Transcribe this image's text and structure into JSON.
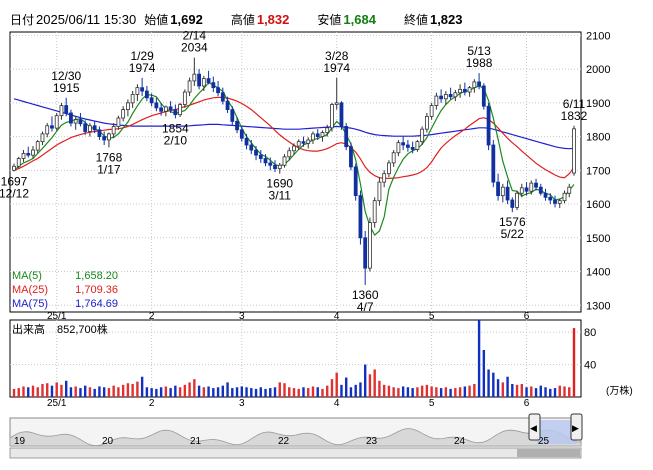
{
  "header": {
    "date_label": "日付",
    "datetime": "2025/06/11 15:30",
    "open_label": "始値",
    "open": "1,692",
    "high_label": "高値",
    "high": "1,832",
    "low_label": "安値",
    "low": "1,684",
    "close_label": "終値",
    "close": "1,823",
    "colors": {
      "high": "#d01010",
      "low": "#108010",
      "text": "#000000"
    }
  },
  "legend": [
    {
      "label": "MA(5)",
      "value": "1,658.20",
      "color": "#1a8a1a"
    },
    {
      "label": "MA(25)",
      "value": "1,709.36",
      "color": "#e02020"
    },
    {
      "label": "MA(75)",
      "value": "1,764.69",
      "color": "#2020d0"
    }
  ],
  "volume_legend": {
    "label": "出来高",
    "value": "852,700株"
  },
  "volume_unit": "(万株)",
  "chart_data": {
    "type": "candlestick",
    "price_axis": {
      "ticks": [
        2100,
        2000,
        1900,
        1800,
        1700,
        1600,
        1500,
        1400,
        1300
      ],
      "ylim": [
        1280,
        2110
      ]
    },
    "volume_axis": {
      "ticks": [
        80,
        40
      ],
      "ylim": [
        0,
        95
      ]
    },
    "month_labels": [
      "25/1",
      "2",
      "3",
      "4",
      "5",
      "6"
    ],
    "month_bar_index": [
      9,
      29,
      48,
      68,
      88,
      108
    ],
    "annotations": [
      {
        "price": "1697",
        "date": "12/12",
        "index": 0,
        "at": "low",
        "pos": "below"
      },
      {
        "price": "1915",
        "date": "12/30",
        "index": 11,
        "at": "high",
        "pos": "above"
      },
      {
        "price": "1768",
        "date": "1/17",
        "index": 20,
        "at": "low",
        "pos": "below"
      },
      {
        "price": "1974",
        "date": "1/29",
        "index": 27,
        "at": "high",
        "pos": "above"
      },
      {
        "price": "1854",
        "date": "2/10",
        "index": 34,
        "at": "low",
        "pos": "below"
      },
      {
        "price": "2034",
        "date": "2/14",
        "index": 38,
        "at": "high",
        "pos": "above"
      },
      {
        "price": "1690",
        "date": "3/11",
        "index": 56,
        "at": "low",
        "pos": "below"
      },
      {
        "price": "1974",
        "date": "3/28",
        "index": 68,
        "at": "high",
        "pos": "above"
      },
      {
        "price": "1360",
        "date": "4/7",
        "index": 74,
        "at": "low",
        "pos": "below"
      },
      {
        "price": "1988",
        "date": "5/13",
        "index": 98,
        "at": "high",
        "pos": "above"
      },
      {
        "price": "1576",
        "date": "5/22",
        "index": 105,
        "at": "low",
        "pos": "below"
      },
      {
        "price": "1832",
        "date": "6/11",
        "index": 118,
        "at": "high",
        "pos": "above"
      }
    ],
    "candles": [
      [
        1700,
        1720,
        1697,
        1712
      ],
      [
        1712,
        1740,
        1705,
        1735
      ],
      [
        1735,
        1760,
        1725,
        1750
      ],
      [
        1750,
        1770,
        1738,
        1745
      ],
      [
        1745,
        1772,
        1735,
        1760
      ],
      [
        1760,
        1790,
        1750,
        1785
      ],
      [
        1785,
        1815,
        1775,
        1808
      ],
      [
        1808,
        1840,
        1798,
        1832
      ],
      [
        1832,
        1860,
        1815,
        1825
      ],
      [
        1825,
        1870,
        1818,
        1862
      ],
      [
        1862,
        1900,
        1850,
        1892
      ],
      [
        1892,
        1915,
        1860,
        1870
      ],
      [
        1870,
        1880,
        1830,
        1840
      ],
      [
        1840,
        1860,
        1820,
        1850
      ],
      [
        1850,
        1870,
        1830,
        1838
      ],
      [
        1838,
        1848,
        1805,
        1815
      ],
      [
        1815,
        1840,
        1800,
        1832
      ],
      [
        1832,
        1845,
        1810,
        1820
      ],
      [
        1820,
        1830,
        1790,
        1800
      ],
      [
        1800,
        1815,
        1775,
        1790
      ],
      [
        1790,
        1812,
        1768,
        1808
      ],
      [
        1808,
        1840,
        1795,
        1830
      ],
      [
        1830,
        1862,
        1820,
        1855
      ],
      [
        1855,
        1890,
        1845,
        1880
      ],
      [
        1880,
        1910,
        1860,
        1900
      ],
      [
        1900,
        1935,
        1885,
        1925
      ],
      [
        1925,
        1955,
        1905,
        1945
      ],
      [
        1945,
        1974,
        1920,
        1935
      ],
      [
        1935,
        1950,
        1905,
        1915
      ],
      [
        1915,
        1928,
        1890,
        1900
      ],
      [
        1900,
        1915,
        1875,
        1885
      ],
      [
        1885,
        1900,
        1862,
        1875
      ],
      [
        1875,
        1892,
        1860,
        1888
      ],
      [
        1888,
        1905,
        1870,
        1880
      ],
      [
        1880,
        1895,
        1854,
        1865
      ],
      [
        1865,
        1900,
        1858,
        1895
      ],
      [
        1895,
        1940,
        1885,
        1932
      ],
      [
        1932,
        1975,
        1920,
        1965
      ],
      [
        1965,
        2034,
        1950,
        1985
      ],
      [
        1985,
        2000,
        1940,
        1950
      ],
      [
        1950,
        1980,
        1935,
        1972
      ],
      [
        1972,
        1995,
        1955,
        1960
      ],
      [
        1960,
        1978,
        1932,
        1945
      ],
      [
        1945,
        1965,
        1920,
        1930
      ],
      [
        1930,
        1945,
        1895,
        1905
      ],
      [
        1905,
        1918,
        1870,
        1880
      ],
      [
        1880,
        1890,
        1835,
        1845
      ],
      [
        1845,
        1858,
        1810,
        1820
      ],
      [
        1820,
        1832,
        1785,
        1795
      ],
      [
        1795,
        1808,
        1762,
        1775
      ],
      [
        1775,
        1790,
        1748,
        1760
      ],
      [
        1760,
        1772,
        1730,
        1745
      ],
      [
        1745,
        1760,
        1722,
        1735
      ],
      [
        1735,
        1748,
        1712,
        1722
      ],
      [
        1722,
        1738,
        1700,
        1715
      ],
      [
        1715,
        1730,
        1695,
        1705
      ],
      [
        1705,
        1722,
        1690,
        1715
      ],
      [
        1715,
        1748,
        1708,
        1740
      ],
      [
        1740,
        1768,
        1730,
        1758
      ],
      [
        1758,
        1780,
        1745,
        1772
      ],
      [
        1772,
        1792,
        1760,
        1785
      ],
      [
        1785,
        1800,
        1770,
        1780
      ],
      [
        1780,
        1798,
        1765,
        1790
      ],
      [
        1790,
        1815,
        1778,
        1808
      ],
      [
        1808,
        1822,
        1790,
        1800
      ],
      [
        1800,
        1818,
        1785,
        1812
      ],
      [
        1812,
        1835,
        1800,
        1826
      ],
      [
        1826,
        1900,
        1815,
        1895
      ],
      [
        1895,
        1974,
        1880,
        1900
      ],
      [
        1900,
        1905,
        1820,
        1830
      ],
      [
        1830,
        1840,
        1760,
        1770
      ],
      [
        1770,
        1782,
        1700,
        1710
      ],
      [
        1710,
        1720,
        1610,
        1625
      ],
      [
        1625,
        1640,
        1480,
        1500
      ],
      [
        1500,
        1520,
        1360,
        1410
      ],
      [
        1410,
        1560,
        1400,
        1545
      ],
      [
        1545,
        1620,
        1530,
        1610
      ],
      [
        1610,
        1680,
        1595,
        1665
      ],
      [
        1665,
        1700,
        1650,
        1690
      ],
      [
        1690,
        1730,
        1680,
        1722
      ],
      [
        1722,
        1760,
        1710,
        1752
      ],
      [
        1752,
        1790,
        1742,
        1782
      ],
      [
        1782,
        1800,
        1760,
        1775
      ],
      [
        1775,
        1790,
        1755,
        1768
      ],
      [
        1768,
        1785,
        1750,
        1762
      ],
      [
        1762,
        1790,
        1755,
        1785
      ],
      [
        1785,
        1830,
        1775,
        1822
      ],
      [
        1822,
        1870,
        1812,
        1860
      ],
      [
        1860,
        1900,
        1850,
        1892
      ],
      [
        1892,
        1930,
        1880,
        1920
      ],
      [
        1920,
        1940,
        1900,
        1912
      ],
      [
        1912,
        1935,
        1895,
        1925
      ],
      [
        1925,
        1945,
        1910,
        1918
      ],
      [
        1918,
        1938,
        1905,
        1930
      ],
      [
        1930,
        1955,
        1915,
        1940
      ],
      [
        1940,
        1960,
        1922,
        1932
      ],
      [
        1932,
        1950,
        1918,
        1945
      ],
      [
        1945,
        1970,
        1930,
        1962
      ],
      [
        1962,
        1988,
        1940,
        1950
      ],
      [
        1950,
        1958,
        1880,
        1890
      ],
      [
        1890,
        1900,
        1760,
        1775
      ],
      [
        1775,
        1790,
        1650,
        1665
      ],
      [
        1665,
        1690,
        1610,
        1625
      ],
      [
        1625,
        1660,
        1605,
        1650
      ],
      [
        1650,
        1670,
        1600,
        1612
      ],
      [
        1612,
        1620,
        1576,
        1590
      ],
      [
        1590,
        1640,
        1582,
        1632
      ],
      [
        1632,
        1660,
        1620,
        1648
      ],
      [
        1648,
        1665,
        1625,
        1638
      ],
      [
        1638,
        1670,
        1628,
        1662
      ],
      [
        1662,
        1675,
        1640,
        1650
      ],
      [
        1650,
        1660,
        1625,
        1632
      ],
      [
        1632,
        1645,
        1610,
        1620
      ],
      [
        1620,
        1632,
        1600,
        1612
      ],
      [
        1612,
        1625,
        1590,
        1602
      ],
      [
        1602,
        1615,
        1588,
        1610
      ],
      [
        1610,
        1640,
        1602,
        1632
      ],
      [
        1632,
        1660,
        1620,
        1650
      ],
      [
        1692,
        1832,
        1684,
        1823
      ]
    ],
    "volumes": [
      10,
      11,
      13,
      12,
      14,
      12,
      16,
      17,
      14,
      18,
      15,
      20,
      12,
      13,
      11,
      14,
      12,
      10,
      13,
      12,
      11,
      14,
      12,
      15,
      17,
      16,
      19,
      25,
      12,
      11,
      10,
      12,
      13,
      11,
      14,
      12,
      15,
      18,
      22,
      14,
      12,
      13,
      11,
      12,
      14,
      18,
      11,
      12,
      13,
      12,
      11,
      10,
      12,
      10,
      11,
      12,
      18,
      17,
      12,
      11,
      10,
      12,
      11,
      13,
      12,
      10,
      14,
      22,
      30,
      15,
      24,
      12,
      15,
      18,
      40,
      28,
      34,
      20,
      15,
      14,
      12,
      11,
      13,
      12,
      11,
      12,
      14,
      15,
      13,
      12,
      11,
      12,
      10,
      11,
      12,
      13,
      14,
      16,
      95,
      58,
      34,
      30,
      22,
      18,
      25,
      16,
      15,
      16,
      12,
      13,
      11,
      14,
      12,
      10,
      11,
      14,
      13,
      12,
      85
    ],
    "ma5": [
      1700,
      1712,
      1722,
      1728,
      1735,
      1750,
      1765,
      1781,
      1797,
      1816,
      1834,
      1842,
      1846,
      1851,
      1853,
      1842,
      1828,
      1823,
      1816,
      1802,
      1795,
      1798,
      1808,
      1826,
      1843,
      1868,
      1891,
      1911,
      1924,
      1923,
      1918,
      1898,
      1882,
      1874,
      1868,
      1873,
      1877,
      1893,
      1913,
      1929,
      1943,
      1960,
      1953,
      1944,
      1934,
      1908,
      1886,
      1856,
      1825,
      1800,
      1782,
      1764,
      1748,
      1741,
      1730,
      1717,
      1713,
      1718,
      1731,
      1747,
      1762,
      1775,
      1781,
      1791,
      1794,
      1800,
      1806,
      1826,
      1845,
      1832,
      1806,
      1779,
      1731,
      1660,
      1578,
      1535,
      1508,
      1520,
      1562,
      1644,
      1680,
      1708,
      1733,
      1749,
      1758,
      1764,
      1777,
      1797,
      1825,
      1852,
      1877,
      1895,
      1909,
      1918,
      1928,
      1934,
      1937,
      1945,
      1950,
      1943,
      1906,
      1855,
      1792,
      1727,
      1680,
      1640,
      1638,
      1624,
      1630,
      1634,
      1644,
      1640,
      1632,
      1628,
      1612,
      1615,
      1622,
      1641,
      1658
    ],
    "ma25": [
      1700,
      1705,
      1712,
      1720,
      1728,
      1735,
      1745,
      1755,
      1765,
      1775,
      1783,
      1790,
      1797,
      1802,
      1806,
      1810,
      1813,
      1815,
      1817,
      1819,
      1821,
      1822,
      1823,
      1826,
      1830,
      1836,
      1843,
      1850,
      1856,
      1862,
      1866,
      1870,
      1874,
      1877,
      1880,
      1884,
      1889,
      1893,
      1898,
      1903,
      1908,
      1912,
      1915,
      1916,
      1916,
      1914,
      1910,
      1905,
      1898,
      1890,
      1880,
      1868,
      1856,
      1844,
      1832,
      1818,
      1805,
      1794,
      1784,
      1774,
      1766,
      1761,
      1758,
      1757,
      1757,
      1760,
      1764,
      1771,
      1779,
      1782,
      1778,
      1768,
      1754,
      1734,
      1710,
      1694,
      1684,
      1678,
      1676,
      1676,
      1677,
      1678,
      1681,
      1683,
      1686,
      1690,
      1697,
      1708,
      1725,
      1747,
      1766,
      1780,
      1792,
      1803,
      1812,
      1822,
      1833,
      1843,
      1853,
      1856,
      1851,
      1840,
      1825,
      1810,
      1795,
      1782,
      1770,
      1757,
      1745,
      1733,
      1721,
      1711,
      1702,
      1694,
      1686,
      1680,
      1678,
      1690,
      1709
    ],
    "ma75": [
      1912,
      1908,
      1904,
      1900,
      1896,
      1892,
      1888,
      1884,
      1880,
      1876,
      1872,
      1868,
      1864,
      1860,
      1856,
      1852,
      1849,
      1846,
      1843,
      1840,
      1838,
      1836,
      1834,
      1833,
      1832,
      1831,
      1831,
      1831,
      1831,
      1831,
      1831,
      1831,
      1831,
      1831,
      1831,
      1831,
      1831,
      1832,
      1833,
      1834,
      1835,
      1836,
      1836,
      1836,
      1835,
      1834,
      1833,
      1832,
      1831,
      1830,
      1829,
      1828,
      1827,
      1826,
      1825,
      1824,
      1823,
      1822,
      1822,
      1822,
      1822,
      1823,
      1824,
      1825,
      1826,
      1827,
      1828,
      1829,
      1830,
      1829,
      1827,
      1825,
      1822,
      1818,
      1813,
      1809,
      1806,
      1804,
      1803,
      1802,
      1801,
      1801,
      1801,
      1801,
      1801,
      1802,
      1803,
      1804,
      1806,
      1808,
      1810,
      1812,
      1814,
      1816,
      1818,
      1820,
      1822,
      1824,
      1826,
      1826,
      1825,
      1822,
      1818,
      1814,
      1810,
      1806,
      1802,
      1798,
      1794,
      1790,
      1786,
      1782,
      1778,
      1774,
      1770,
      1767,
      1765,
      1764,
      1765
    ]
  },
  "navigator": {
    "labels": [
      "19",
      "20",
      "21",
      "22",
      "23",
      "24",
      "25"
    ],
    "prev_label": "◀",
    "next_label": "▶"
  }
}
